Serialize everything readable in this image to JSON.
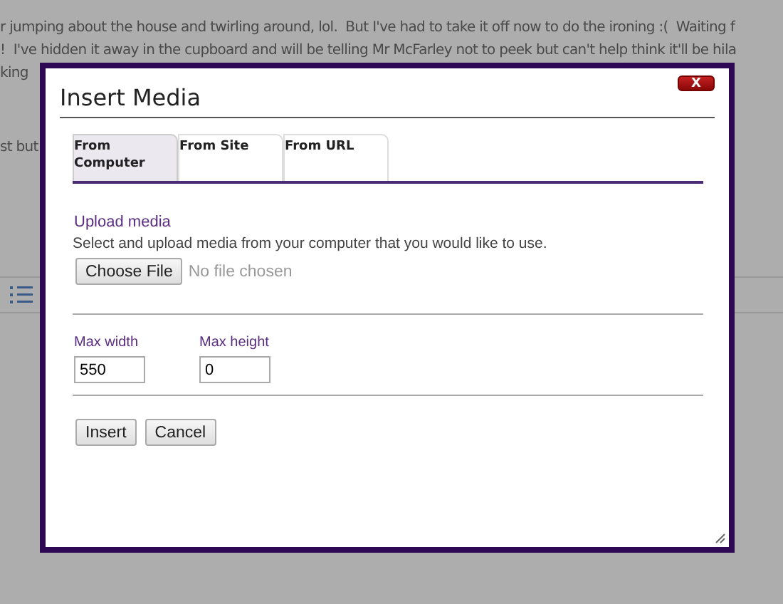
{
  "background_text": [
    "r jumping about the house and twirling around, lol.  But I've had to take it off now to do the ironing :(  Waiting f",
    "!  I've hidden it away in the cupboard and will be telling Mr McFarley not to peek but can't help think it'll be hila",
    "king",
    "st but"
  ],
  "dialog": {
    "title": "Insert Media",
    "close": "X",
    "tabs": [
      {
        "label": "From Computer",
        "selected": true
      },
      {
        "label": "From Site",
        "selected": false
      },
      {
        "label": "From URL",
        "selected": false
      }
    ],
    "section_title": "Upload media",
    "description": "Select and upload media from your computer that you would like to use.",
    "file_button": "Choose File",
    "file_status": "No file chosen",
    "fields": [
      {
        "label": "Max width",
        "value": "550"
      },
      {
        "label": "Max height",
        "value": "0"
      }
    ],
    "buttons": [
      "Insert",
      "Cancel"
    ]
  }
}
